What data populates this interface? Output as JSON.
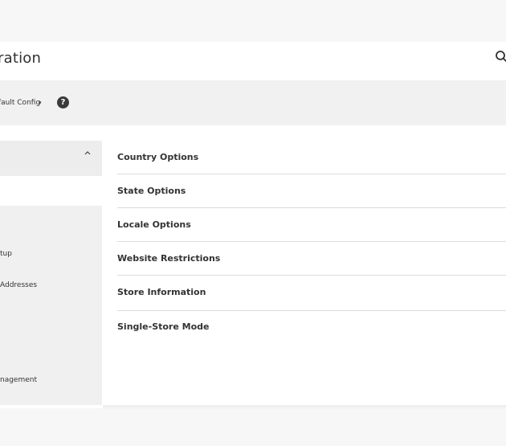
{
  "header": {
    "title": "ration",
    "search_icon": "search-icon"
  },
  "scope": {
    "label": "fault Config",
    "caret": "▾",
    "help_symbol": "?"
  },
  "sidebar": {
    "collapse_icon": "chevron-up-icon",
    "items": [
      {
        "label": "tup"
      },
      {
        "label": "Addresses"
      },
      {
        "label": "nagement"
      }
    ]
  },
  "groups": [
    {
      "title": "Country Options"
    },
    {
      "title": "State Options"
    },
    {
      "title": "Locale Options"
    },
    {
      "title": "Website Restrictions"
    },
    {
      "title": "Store Information"
    },
    {
      "title": "Single-Store Mode"
    }
  ]
}
